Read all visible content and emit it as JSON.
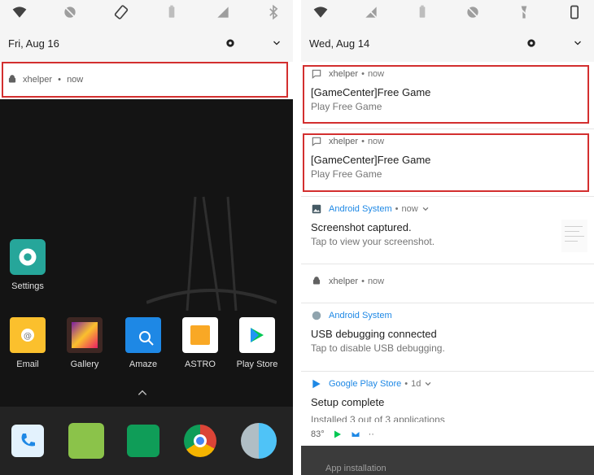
{
  "left": {
    "date": "Fri, Aug 16",
    "notification": {
      "app": "xhelper",
      "time": "now"
    },
    "apps": [
      {
        "label": "Settings",
        "icon": "gear-icon"
      },
      {
        "label": "Email",
        "icon": "email-icon"
      },
      {
        "label": "Gallery",
        "icon": "gallery-icon"
      },
      {
        "label": "Amaze",
        "icon": "folder-search-icon"
      },
      {
        "label": "ASTRO",
        "icon": "astro-icon"
      },
      {
        "label": "Play Store",
        "icon": "play-store-icon"
      }
    ],
    "dock": [
      "phone-icon",
      "messenger-icon",
      "hangouts-icon",
      "chrome-icon",
      "camera-icon"
    ]
  },
  "right": {
    "date": "Wed, Aug 14",
    "notifications": [
      {
        "app": "xhelper",
        "time": "now",
        "title": "[GameCenter]Free Game",
        "text": "Play Free Game"
      },
      {
        "app": "xhelper",
        "time": "now",
        "title": "[GameCenter]Free Game",
        "text": "Play Free Game"
      },
      {
        "app": "Android System",
        "time": "now",
        "title": "Screenshot captured.",
        "text": "Tap to view your screenshot."
      },
      {
        "app": "xhelper",
        "time": "now"
      },
      {
        "app": "Android System",
        "title": "USB debugging connected",
        "text": "Tap to disable USB debugging."
      },
      {
        "app": "Google Play Store",
        "time": "1d",
        "title": "Setup complete",
        "text": "Installed 3 out of 3 applications"
      }
    ],
    "status": {
      "temperature": "83°",
      "more": "··"
    },
    "faded": "App installation"
  },
  "colors": {
    "highlight": "#d32f2f",
    "accent": "#1e88e5"
  }
}
